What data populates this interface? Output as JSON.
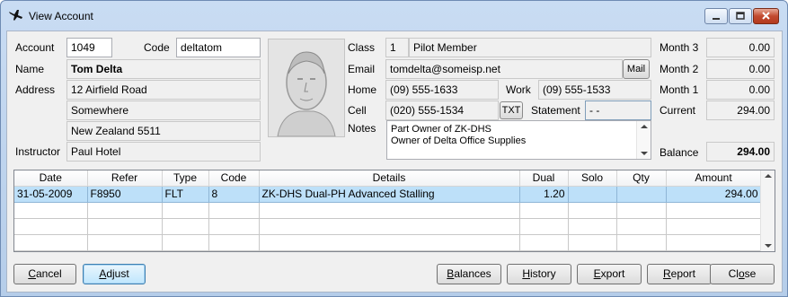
{
  "window": {
    "title": "View Account",
    "icon": "plane-icon",
    "accent": "#b5cde9"
  },
  "account": {
    "account_label": "Account",
    "account_value": "1049",
    "code_label": "Code",
    "code_value": "deltatom",
    "name_label": "Name",
    "name_value": "Tom Delta",
    "address_label": "Address",
    "address_lines": [
      "12 Airfield Road",
      "Somewhere",
      "New Zealand 5511"
    ],
    "instructor_label": "Instructor",
    "instructor_value": "Paul Hotel"
  },
  "contact": {
    "class_label": "Class",
    "class_num": "1",
    "class_value": "Pilot Member",
    "email_label": "Email",
    "email_value": "tomdelta@someisp.net",
    "mail_button": "Mail",
    "home_label": "Home",
    "home_value": "(09) 555-1633",
    "work_label": "Work",
    "work_value": "(09) 555-1533",
    "cell_label": "Cell",
    "cell_value": "(020) 555-1534",
    "txt_button": "TXT",
    "statement_label": "Statement",
    "statement_value": "- -",
    "notes_label": "Notes",
    "notes_lines": [
      "Part Owner of ZK-DHS",
      "Owner of Delta Office Supplies"
    ]
  },
  "balances": {
    "month3_label": "Month 3",
    "month3_value": "0.00",
    "month2_label": "Month 2",
    "month2_value": "0.00",
    "month1_label": "Month 1",
    "month1_value": "0.00",
    "current_label": "Current",
    "current_value": "294.00",
    "balance_label": "Balance",
    "balance_value": "294.00"
  },
  "grid": {
    "columns": [
      "Date",
      "Refer",
      "Type",
      "Code",
      "Details",
      "Dual",
      "Solo",
      "Qty",
      "Amount"
    ],
    "rows": [
      [
        "31-05-2009",
        "F8950",
        "FLT",
        "8",
        "ZK-DHS Dual-PH  Advanced Stalling",
        "1.20",
        "",
        "",
        "294.00"
      ]
    ]
  },
  "buttons": {
    "cancel_pre": "",
    "cancel_ul": "C",
    "cancel_post": "ancel",
    "adjust_pre": "",
    "adjust_ul": "A",
    "adjust_post": "djust",
    "balances_pre": "",
    "balances_ul": "B",
    "balances_post": "alances",
    "history_pre": "",
    "history_ul": "H",
    "history_post": "istory",
    "export_pre": "",
    "export_ul": "E",
    "export_post": "xport",
    "report_pre": "",
    "report_ul": "R",
    "report_post": "eport",
    "close_pre": "Cl",
    "close_ul": "o",
    "close_post": "se"
  }
}
